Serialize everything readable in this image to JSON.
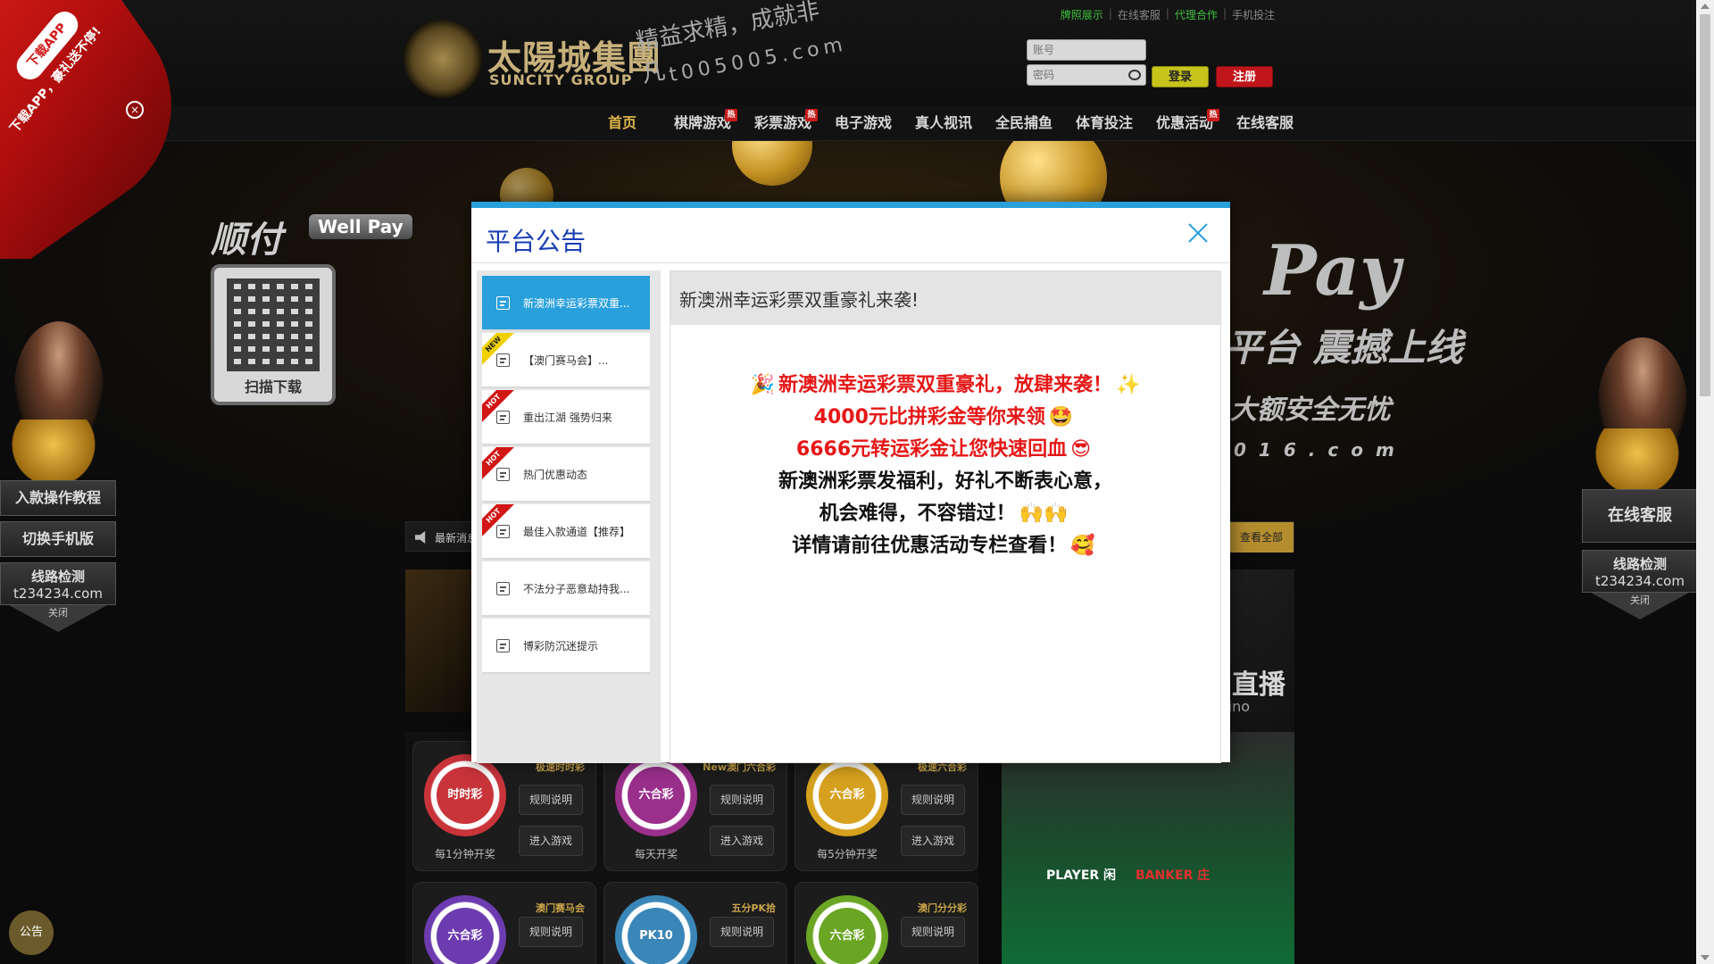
{
  "ribbon": {
    "pill": "下载APP",
    "text": "下载APP，豪礼送不停!",
    "close": "×"
  },
  "header": {
    "logo_cn": "太陽城集團",
    "logo_en": "SUNCITY GROUP",
    "slogan": "精益求精，成就非凡",
    "domain": "t005005.com",
    "toplinks": [
      "牌照展示",
      "在线客服",
      "代理合作",
      "手机投注"
    ],
    "username_placeholder": "账号",
    "password_placeholder": "密码",
    "login_label": "登录",
    "register_label": "注册"
  },
  "nav": {
    "items": [
      {
        "label": "首页",
        "hot": false
      },
      {
        "label": "棋牌游戏",
        "hot": true
      },
      {
        "label": "彩票游戏",
        "hot": true
      },
      {
        "label": "电子游戏",
        "hot": false
      },
      {
        "label": "真人视讯",
        "hot": false
      },
      {
        "label": "全民捕鱼",
        "hot": false
      },
      {
        "label": "体育投注",
        "hot": false
      },
      {
        "label": "优惠活动",
        "hot": true
      },
      {
        "label": "在线客服",
        "hot": false
      }
    ],
    "hot_label": "热"
  },
  "banner": {
    "brand_cn": "顺付",
    "brand_en": "Well Pay",
    "qr_label": "扫描下载",
    "pay_title": "Pay",
    "line2": "平台 震撼上线",
    "line3": "大额安全无忧",
    "line4": "016.com"
  },
  "ticker": {
    "label": "最新消息",
    "view_all": "查看全部"
  },
  "live": {
    "title": "直播",
    "sub": "ino"
  },
  "games": [
    {
      "name": "极速时时彩",
      "ball": "时时彩",
      "freq": "每1分钟开奖",
      "color": "#c8343a"
    },
    {
      "name": "New澳门六合彩",
      "ball": "六合彩",
      "freq": "每天开奖",
      "color": "#9b2f8c"
    },
    {
      "name": "极速六合彩",
      "ball": "六合彩",
      "freq": "每5分钟开奖",
      "color": "#d6a11e"
    },
    {
      "name": "澳门赛马会",
      "ball": "六合彩",
      "freq": "",
      "color": "#6d3bb0"
    },
    {
      "name": "五分PK拾",
      "ball": "PK10",
      "freq": "",
      "color": "#3a86b8"
    },
    {
      "name": "澳门分分彩",
      "ball": "六合彩",
      "freq": "",
      "color": "#6aa524"
    }
  ],
  "game_buttons": {
    "rules": "规则说明",
    "enter": "进入游戏"
  },
  "baccarat": {
    "player": "PLAYER 闲",
    "banker": "BANKER 庄"
  },
  "side_left": {
    "deposit": "入款操作教程",
    "mobile": "切换手机版",
    "detect_title": "线路检测",
    "detect_domain": "t234234.com",
    "close": "关闭"
  },
  "side_right": {
    "service": "在线客服",
    "detect_title": "线路检测",
    "detect_domain": "t234234.com",
    "close": "关闭"
  },
  "notice_button": "公告",
  "modal": {
    "title": "平台公告",
    "tabs": [
      {
        "label": "新澳洲幸运彩票双重...",
        "badge": ""
      },
      {
        "label": "【澳门赛马会】...",
        "badge": "NEW"
      },
      {
        "label": "重出江湖 强势归来",
        "badge": "HOT"
      },
      {
        "label": "热门优惠动态",
        "badge": "HOT"
      },
      {
        "label": "最佳入款通道【推荐】",
        "badge": "HOT"
      },
      {
        "label": "不法分子恶意劫持我...",
        "badge": ""
      },
      {
        "label": "博彩防沉迷提示",
        "badge": ""
      }
    ],
    "content_title": "新澳洲幸运彩票双重豪礼来袭!",
    "content_lines": [
      {
        "text": "新澳洲幸运彩票双重豪礼，放肆来袭！",
        "color": "red",
        "pre": "🎉",
        "post": "✨"
      },
      {
        "text": "4000元比拼彩金等你来领",
        "color": "red",
        "pre": "",
        "post": "🤩"
      },
      {
        "text": "6666元转运彩金让您快速回血",
        "color": "red",
        "pre": "",
        "post": "😎"
      },
      {
        "text": "新澳洲彩票发福利，好礼不断表心意，",
        "color": "black",
        "pre": "",
        "post": ""
      },
      {
        "text": "机会难得，不容错过！",
        "color": "black",
        "pre": "",
        "post": "🙌🙌"
      },
      {
        "text": "详情请前往优惠活动专栏查看！",
        "color": "black",
        "pre": "",
        "post": "🥰"
      }
    ]
  }
}
